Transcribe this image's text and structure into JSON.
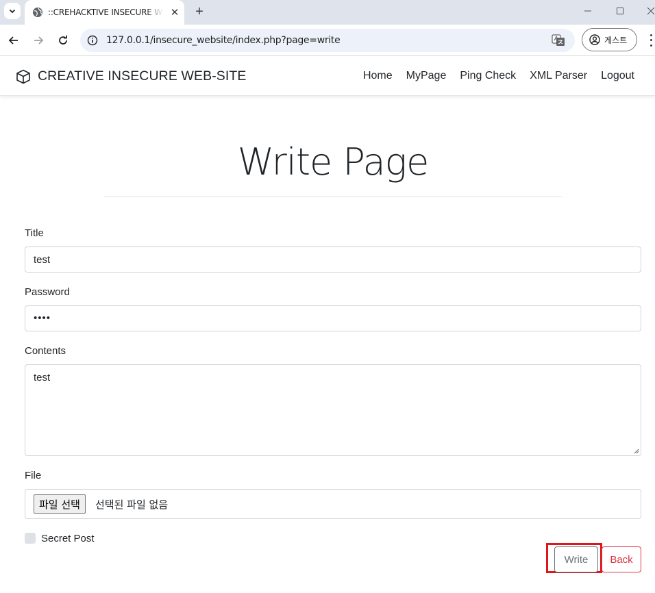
{
  "browser": {
    "tab_title": "::CREHACKTIVE INSECURE WEB-SITE",
    "url": "127.0.0.1/insecure_website/index.php?page=write",
    "profile_label": "게스트"
  },
  "navbar": {
    "brand": "CREATIVE INSECURE WEB-SITE",
    "links": [
      "Home",
      "MyPage",
      "Ping Check",
      "XML Parser",
      "Logout"
    ]
  },
  "page": {
    "heading": "Write Page"
  },
  "form": {
    "title_label": "Title",
    "title_value": "test",
    "password_label": "Password",
    "password_value": "••••",
    "contents_label": "Contents",
    "contents_value": "test",
    "file_label": "File",
    "file_button": "파일 선택",
    "file_status": "선택된 파일 없음",
    "secret_label": "Secret Post",
    "secret_checked": false,
    "write_button": "Write",
    "back_button": "Back"
  },
  "colors": {
    "highlight": "#e0161c",
    "back_accent": "#dc3545",
    "write_accent": "#6c757d"
  }
}
